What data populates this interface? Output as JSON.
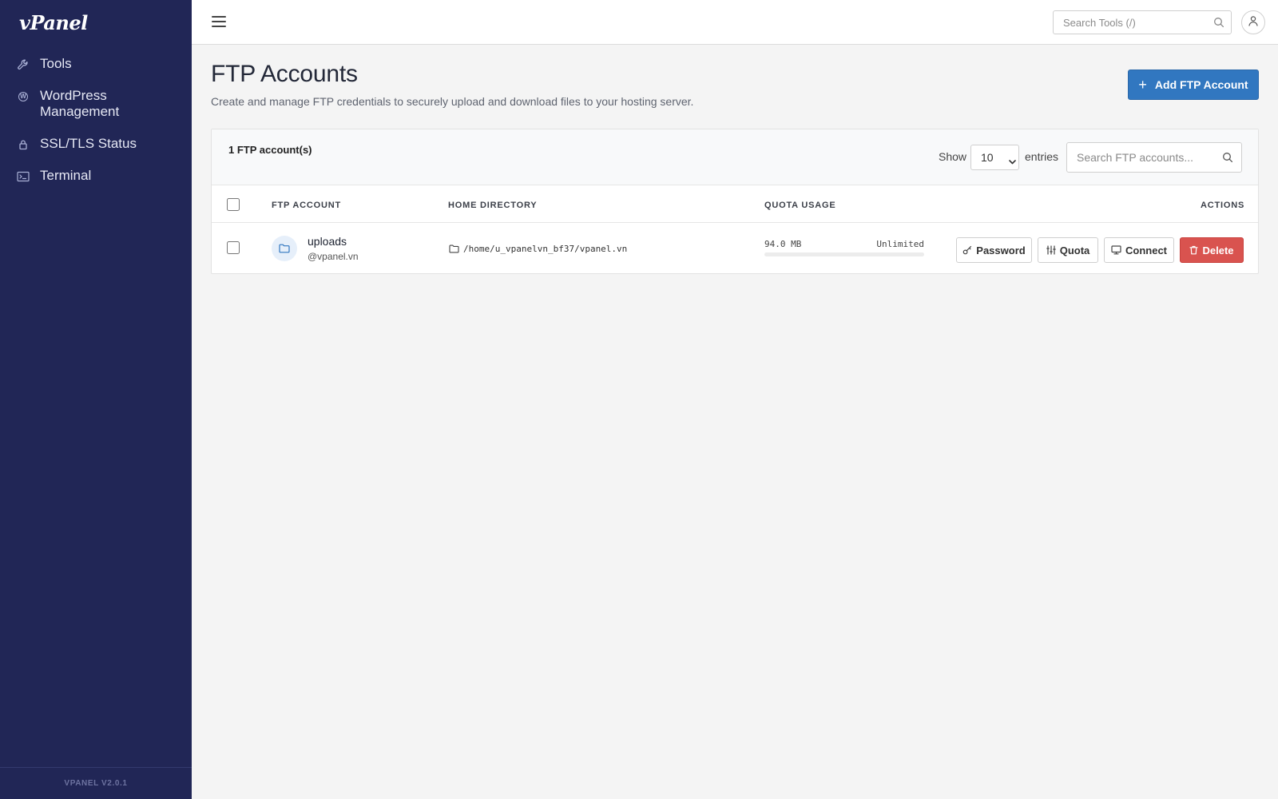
{
  "sidebar": {
    "logo": "vPanel",
    "items": [
      {
        "label": "Tools",
        "icon": "wrench-icon"
      },
      {
        "label": "WordPress Management",
        "icon": "wordpress-icon"
      },
      {
        "label": "SSL/TLS Status",
        "icon": "lock-icon"
      },
      {
        "label": "Terminal",
        "icon": "terminal-icon"
      }
    ],
    "version": "VPANEL V2.0.1"
  },
  "topbar": {
    "search_placeholder": "Search Tools (/)",
    "menu_icon": "hamburger-icon",
    "user_icon": "user-icon"
  },
  "page": {
    "title": "FTP Accounts",
    "subtitle": "Create and manage FTP credentials to securely upload and download files to your hosting server.",
    "add_button": "Add FTP Account"
  },
  "table": {
    "count_label": "1 FTP account(s)",
    "show_label": "Show",
    "entries_label": "entries",
    "entries_value": "10",
    "entries_options": [
      "10"
    ],
    "search_placeholder": "Search FTP accounts...",
    "headers": {
      "account": "FTP ACCOUNT",
      "directory": "HOME DIRECTORY",
      "quota": "QUOTA USAGE",
      "actions": "ACTIONS"
    },
    "rows": [
      {
        "name": "uploads",
        "domain": "@vpanel.vn",
        "directory": "/home/u_vpanelvn_bf37/vpanel.vn",
        "quota_used": "94.0 MB",
        "quota_limit": "Unlimited",
        "quota_fraction": 0,
        "actions": {
          "password": "Password",
          "quota": "Quota",
          "connect": "Connect",
          "delete": "Delete"
        }
      }
    ]
  },
  "colors": {
    "sidebar_bg": "#212656",
    "primary": "#3177c0",
    "danger": "#d9534f",
    "page_bg": "#f4f4f4"
  }
}
